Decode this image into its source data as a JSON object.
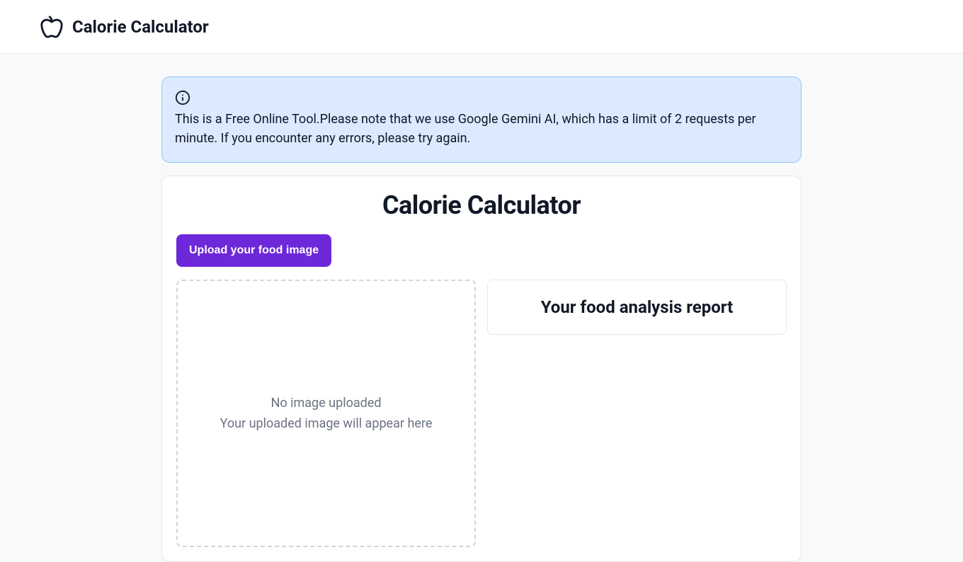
{
  "header": {
    "app_title": "Calorie Calculator"
  },
  "banner": {
    "text": "This is a Free Online Tool.Please note that we use Google Gemini AI, which has a limit of 2 requests per minute. If you encounter any errors, please try again."
  },
  "main": {
    "title": "Calorie Calculator",
    "upload_button_label": "Upload your food image",
    "dropzone": {
      "title": "No image uploaded",
      "subtitle": "Your uploaded image will appear here"
    },
    "report": {
      "title": "Your food analysis report"
    }
  },
  "colors": {
    "primary": "#6d28d9",
    "banner_bg": "#dbeafe",
    "banner_border": "#93c5fd"
  }
}
